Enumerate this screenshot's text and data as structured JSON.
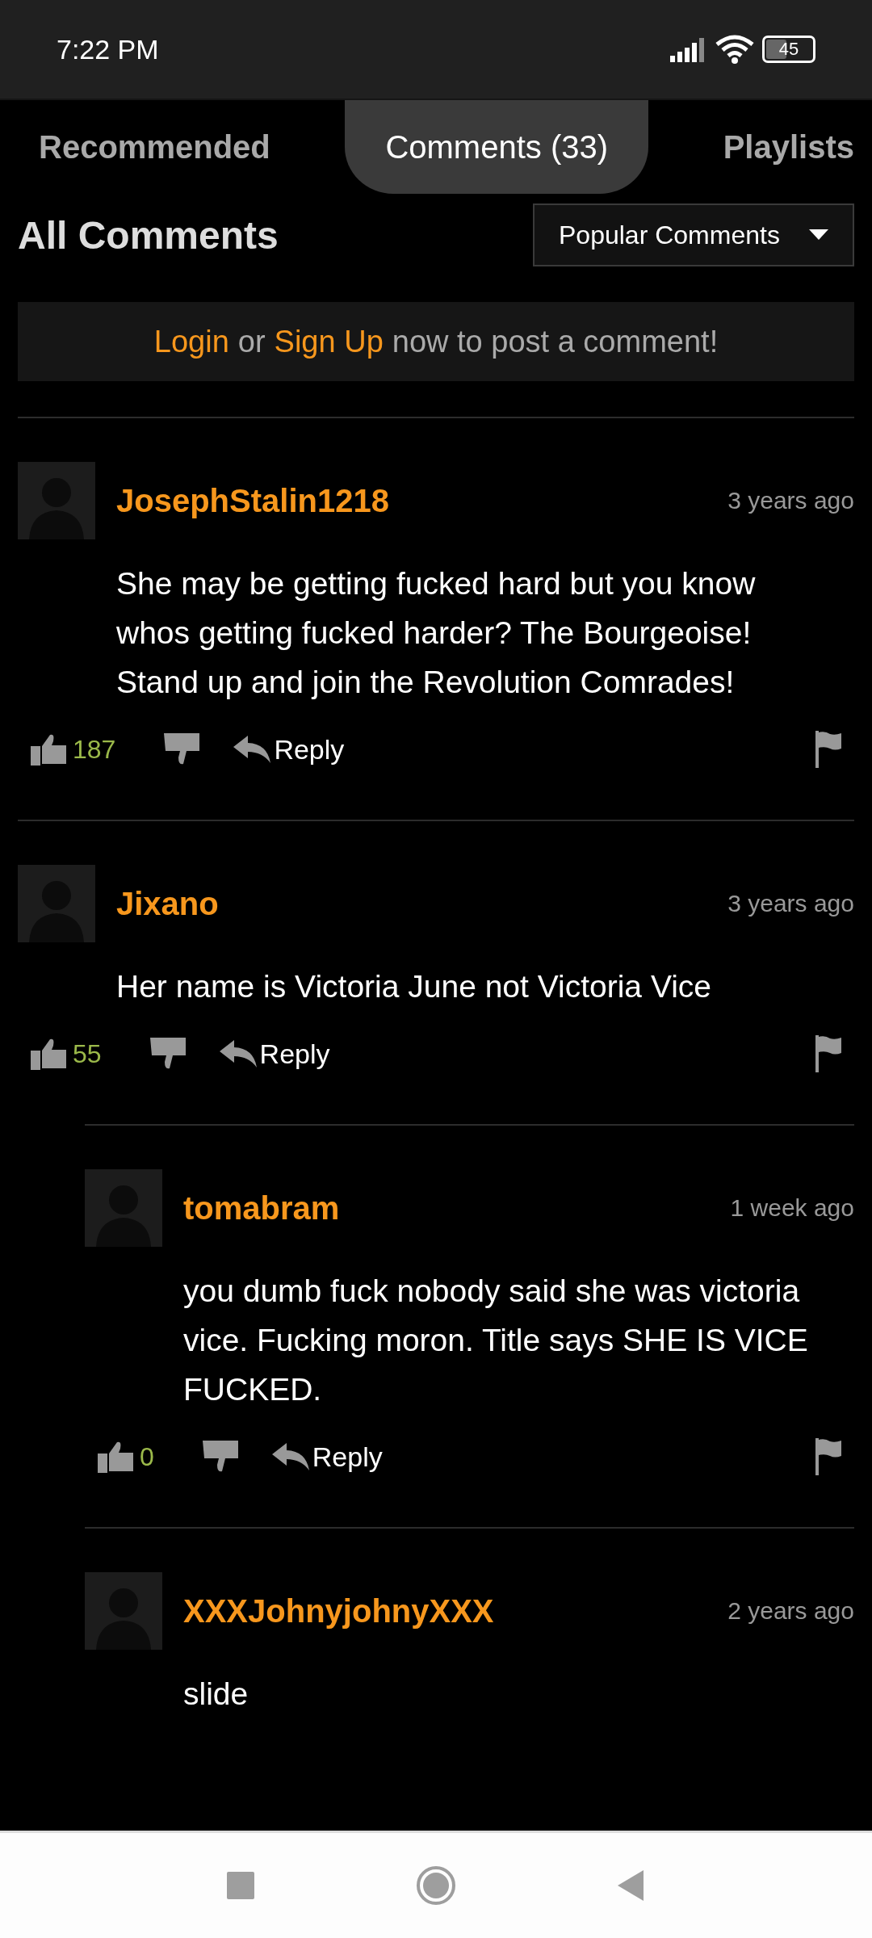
{
  "status_bar": {
    "time": "7:22 PM",
    "battery": "45"
  },
  "tabs": [
    {
      "label": "Recommended",
      "selected": false
    },
    {
      "label": "Comments (33)",
      "selected": true
    },
    {
      "label": "Playlists",
      "selected": false
    }
  ],
  "section_title": "All Comments",
  "sort_dropdown": {
    "value": "Popular Comments"
  },
  "login_prompt": {
    "login_link": "Login",
    "or_text": "or",
    "signup_link": "Sign Up",
    "rest_text": "now to post a comment!"
  },
  "comments": [
    {
      "username": "JosephStalin1218",
      "time": "3 years ago",
      "text": "She may be getting fucked hard but you know whos getting fucked harder? The Bourgeoise! Stand up and join the Revolution Comrades!",
      "likes": "187",
      "reply_label": "Reply"
    },
    {
      "username": "Jixano",
      "time": "3 years ago",
      "text": "Her name is Victoria June not Victoria Vice",
      "likes": "55",
      "reply_label": "Reply",
      "children": [
        {
          "username": "tomabram",
          "time": "1 week ago",
          "text": "you dumb fuck nobody said she was victoria vice. Fucking moron. Title says SHE IS VICE FUCKED.",
          "likes": "0",
          "reply_label": "Reply"
        },
        {
          "username": "XXXJohnyjohnyXXX",
          "time": "2 years ago",
          "text": "slide"
        }
      ]
    }
  ]
}
